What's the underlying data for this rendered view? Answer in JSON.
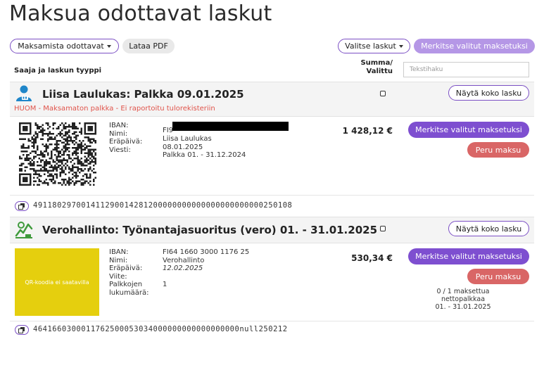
{
  "page": {
    "title": "Maksua odottavat laskut"
  },
  "toolbar": {
    "filter_label": "Maksamista odottavat",
    "download_pdf_label": "Lataa PDF",
    "select_invoices_label": "Valitse laskut",
    "mark_selected_paid_label": "Merkitse valitut maksetuksi"
  },
  "table_header": {
    "recipient_col": "Saaja ja laskun tyyppi",
    "sum_col_line1": "Summa/",
    "sum_col_line2": "Valittu",
    "search_placeholder": "Tekstihaku"
  },
  "invoices": [
    {
      "title": "Liisa Laulukas: Palkka 09.01.2025",
      "warning": "HUOM - Maksamaton palkka - Ei raportoitu tulorekisteriin",
      "show_full_label": "Näytä koko lasku",
      "labels": "IBAN:\nNimi:\nEräpäivä:\nViesti:",
      "iban": "FI9",
      "name": "Liisa Laulukas",
      "due_date": "08.01.2025",
      "message": "Palkka 01. - 31.12.2024",
      "amount": "1 428,12 €",
      "mark_paid_label": "Merkitse valitut maksetuksi",
      "cancel_label": "Peru maksu",
      "reference": "491180297001411290014281200000000000000000000000250108",
      "icon": "person-icon",
      "icon_color": "#1f86c9"
    },
    {
      "title": "Verohallinto: Työnantajasuoritus (vero) 01. - 31.01.2025",
      "show_full_label": "Näytä koko lasku",
      "labels": "IBAN:\nNimi:\nEräpäivä:\nViite:\nPalkkojen\nlukumäärä:",
      "iban": "FI64 1660 3000 1176 25",
      "name": "Verohallinto",
      "due_date": "12.02.2025",
      "reference_field": "",
      "payroll_count": "1",
      "amount": "530,34 €",
      "qr_unavailable": "QR-koodia ei saatavilla",
      "qr_color": "#e5cf0e",
      "mark_paid_label": "Merkitse valitut maksetuksi",
      "cancel_label": "Peru maksu",
      "note_line1": "0 / 1 maksettua",
      "note_line2": "nettopalkkaa",
      "note_line3": "01. - 31.01.2025",
      "reference": "4641660300011762500053034000000000000000000null250212",
      "icon": "tax-authority-logo-icon",
      "icon_color": "#3f9a3c"
    }
  ],
  "colors": {
    "accent": "#7e4fd0",
    "danger": "#d96666",
    "warning_text": "#e0534a"
  }
}
